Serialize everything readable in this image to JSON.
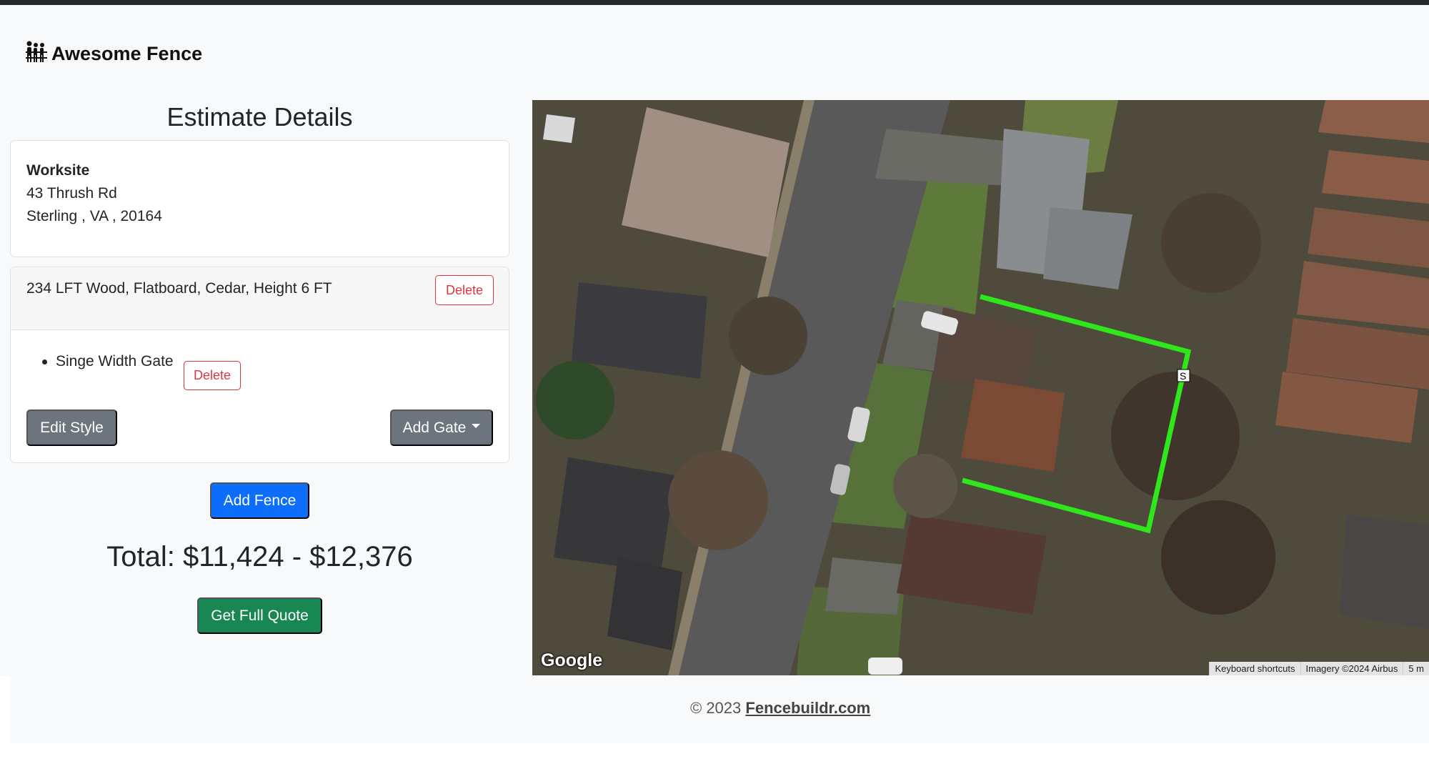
{
  "brand": {
    "name": "Awesome Fence",
    "icon": "fence-people-icon"
  },
  "estimate": {
    "title": "Estimate Details",
    "worksite": {
      "label": "Worksite",
      "street": "43 Thrush Rd",
      "city_line": "Sterling , VA , 20164"
    },
    "fence": {
      "description": "234 LFT Wood, Flatboard, Cedar, Height 6 FT",
      "delete_label": "Delete",
      "gates": [
        {
          "name": "Singe Width Gate",
          "delete_label": "Delete"
        }
      ],
      "edit_style_label": "Edit Style",
      "add_gate_label": "Add Gate"
    },
    "add_fence_label": "Add Fence",
    "total": "Total: $11,424 - $12,376",
    "get_quote_label": "Get Full Quote"
  },
  "map": {
    "provider_logo": "Google",
    "keyboard_shortcuts": "Keyboard shortcuts",
    "imagery": "Imagery ©2024 Airbus",
    "scale": "5 m",
    "fence_marker": "S",
    "fence_color": "#2ee81c"
  },
  "footer": {
    "copyright": "© 2023 ",
    "site_link": "Fencebuildr.com"
  },
  "colors": {
    "primary": "#0d6efd",
    "success": "#198754",
    "secondary": "#6c757d",
    "danger": "#dc3545"
  }
}
